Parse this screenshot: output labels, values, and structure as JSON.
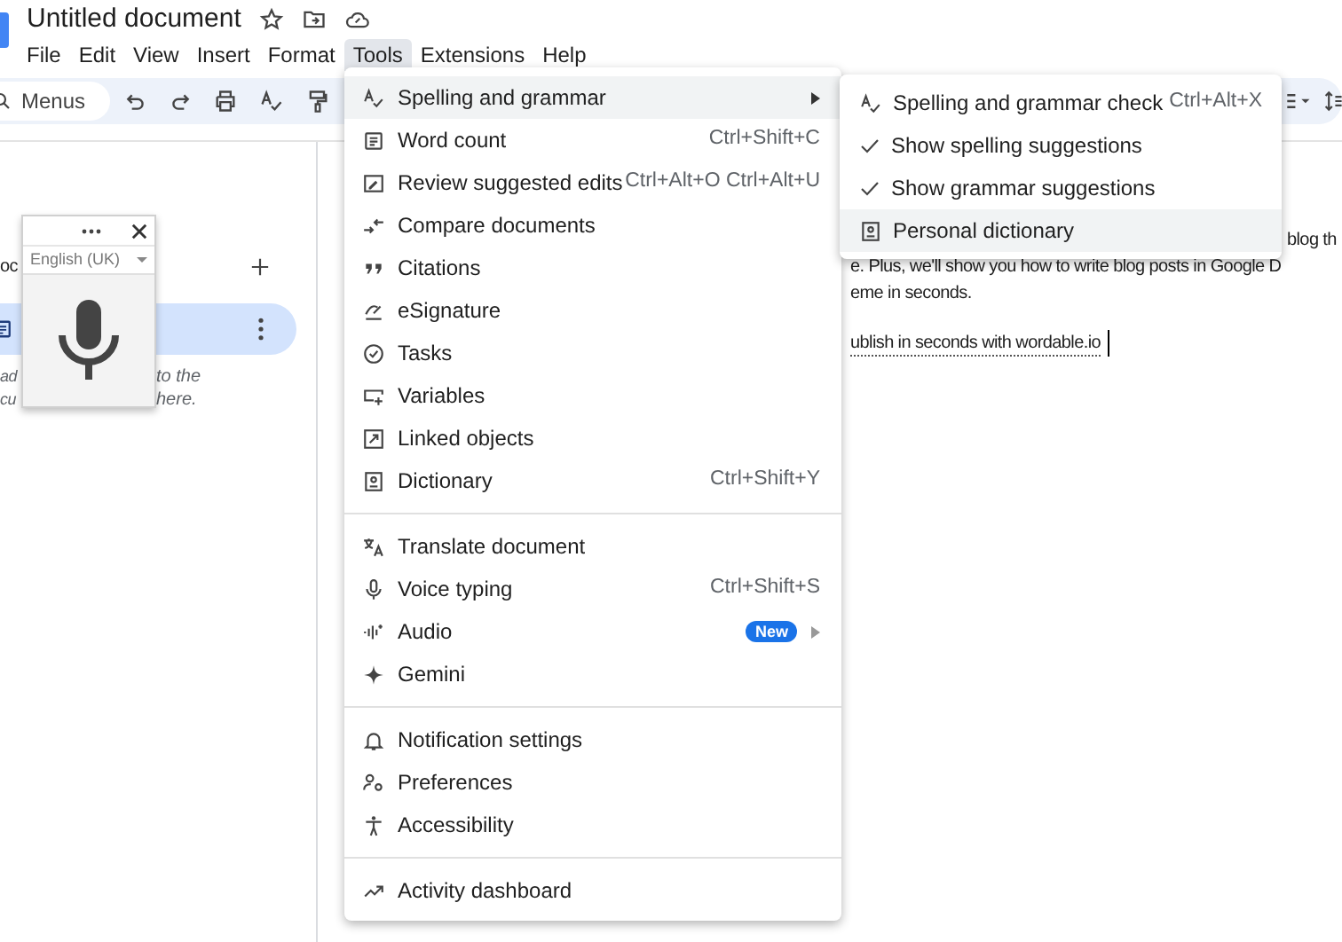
{
  "document": {
    "title": "Untitled document"
  },
  "menu_bar": [
    {
      "label": "File",
      "selected": false
    },
    {
      "label": "Edit",
      "selected": false
    },
    {
      "label": "View",
      "selected": false
    },
    {
      "label": "Insert",
      "selected": false
    },
    {
      "label": "Format",
      "selected": false
    },
    {
      "label": "Tools",
      "selected": true
    },
    {
      "label": "Extensions",
      "selected": false
    },
    {
      "label": "Help",
      "selected": false
    }
  ],
  "toolbar": {
    "search": {
      "placeholder": "Menus"
    }
  },
  "sidebar": {
    "heading": "oc",
    "tab": {
      "selected": true
    },
    "hint_lines": [
      {
        "start": "ad",
        "end": "to the"
      },
      {
        "start": "cu",
        "end": "here."
      }
    ]
  },
  "document_body": {
    "lines": [
      {
        "kind": "tail",
        "text": "blog th"
      },
      {
        "kind": "plain",
        "text": "e. Plus, we'll show you how to write blog posts in Google D"
      },
      {
        "kind": "plain",
        "text": "eme in seconds."
      },
      {
        "kind": "link",
        "text": "ublish in seconds with wordable.io"
      }
    ]
  },
  "voice_typing_panel": {
    "language": "English (UK)"
  },
  "tools_menu": {
    "groups": [
      [
        {
          "label": "Spelling and grammar",
          "selected": true,
          "submenu": true
        },
        {
          "label": "Word count",
          "shortcut": "Ctrl+Shift+C",
          "selected": false,
          "submenu": false
        },
        {
          "label": "Review suggested edits",
          "shortcut": "Ctrl+Alt+O Ctrl+Alt+U",
          "selected": false,
          "submenu": false
        },
        {
          "label": "Compare documents",
          "selected": false,
          "submenu": false
        },
        {
          "label": "Citations",
          "selected": false,
          "submenu": false
        },
        {
          "label": "eSignature",
          "selected": false,
          "submenu": false
        },
        {
          "label": "Tasks",
          "selected": false,
          "submenu": false
        },
        {
          "label": "Variables",
          "selected": false,
          "submenu": false
        },
        {
          "label": "Linked objects",
          "selected": false,
          "submenu": false
        },
        {
          "label": "Dictionary",
          "shortcut": "Ctrl+Shift+Y",
          "selected": false,
          "submenu": false
        }
      ],
      [
        {
          "label": "Translate document",
          "selected": false,
          "submenu": false
        },
        {
          "label": "Voice typing",
          "shortcut": "Ctrl+Shift+S",
          "selected": false,
          "submenu": false
        },
        {
          "label": "Audio",
          "badge": "New",
          "selected": false,
          "submenu": true
        },
        {
          "label": "Gemini",
          "selected": false,
          "submenu": false
        }
      ],
      [
        {
          "label": "Notification settings",
          "selected": false,
          "submenu": false
        },
        {
          "label": "Preferences",
          "selected": false,
          "submenu": false
        },
        {
          "label": "Accessibility",
          "selected": false,
          "submenu": false
        }
      ],
      [
        {
          "label": "Activity dashboard",
          "selected": false,
          "submenu": false
        }
      ]
    ]
  },
  "spelling_submenu": [
    {
      "kind": "command",
      "label": "Spelling and grammar check",
      "shortcut": "Ctrl+Alt+X",
      "selected": false
    },
    {
      "kind": "toggle",
      "label": "Show spelling suggestions",
      "checked": true,
      "selected": false
    },
    {
      "kind": "toggle",
      "label": "Show grammar suggestions",
      "checked": true,
      "selected": false
    },
    {
      "kind": "command",
      "label": "Personal dictionary",
      "selected": true
    }
  ]
}
